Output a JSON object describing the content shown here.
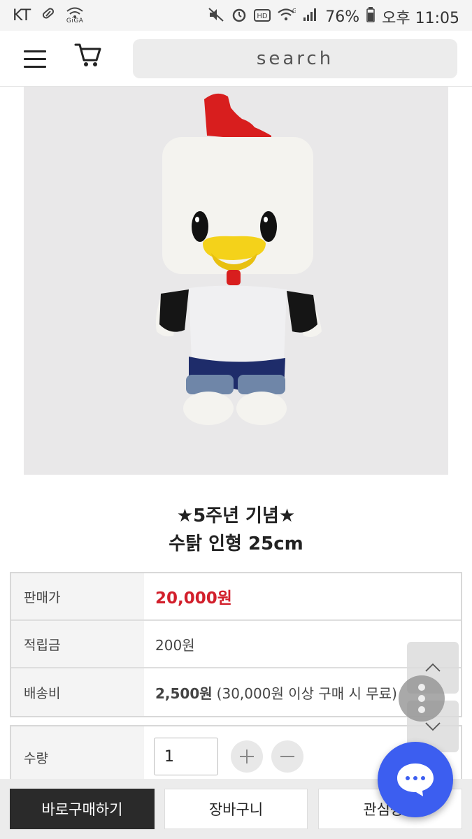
{
  "status_bar": {
    "carrier": "KT",
    "giga_label": "GiGA",
    "battery": "76%",
    "time": "오후 11:05"
  },
  "header": {
    "search_placeholder": "search"
  },
  "product": {
    "title_line1": "★5주년 기념★",
    "title_line2": "수탉 인형 25cm"
  },
  "info": {
    "price_label": "판매가",
    "price_value": "20,000원",
    "points_label": "적립금",
    "points_value": "200원",
    "shipping_label": "배송비",
    "shipping_value": "2,500원",
    "shipping_note": "(30,000원 이상 구매 시 무료)"
  },
  "quantity": {
    "label": "수량",
    "value": "1"
  },
  "actions": {
    "buy_now": "바로구매하기",
    "cart": "장바구니",
    "wishlist": "관심상품"
  },
  "colors": {
    "price": "#d21f2b",
    "chat": "#3c5ef0",
    "buy_button": "#2a2a2a"
  }
}
